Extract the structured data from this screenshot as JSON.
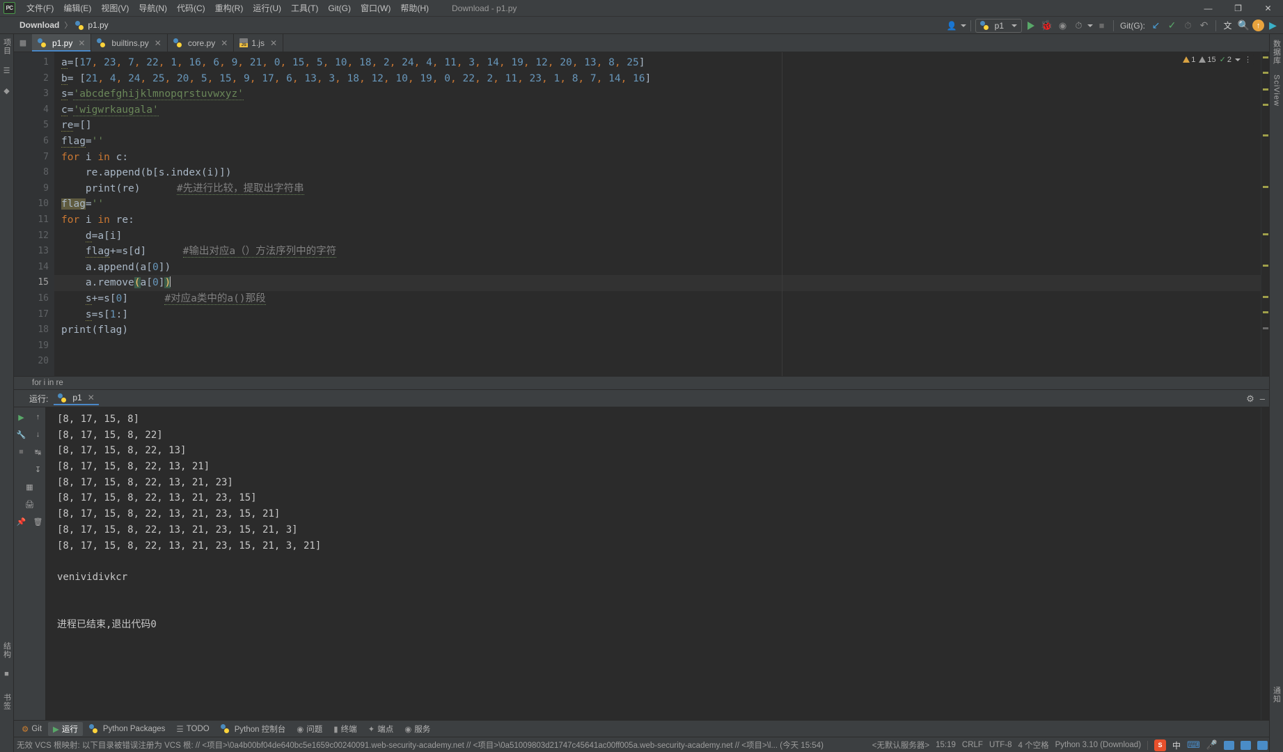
{
  "titlebar": {
    "logo": "PC",
    "menus": [
      "文件(F)",
      "编辑(E)",
      "视图(V)",
      "导航(N)",
      "代码(C)",
      "重构(R)",
      "运行(U)",
      "工具(T)",
      "Git(G)",
      "窗口(W)",
      "帮助(H)"
    ],
    "window_title": "Download - p1.py",
    "minimize": "—",
    "maximize": "❐",
    "close": "✕"
  },
  "navbar": {
    "project": "Download",
    "separator": "〉",
    "file": "p1.py",
    "run_config": "p1",
    "git_label": "Git(G):",
    "icons": {
      "user": "user-icon",
      "run": "run-icon",
      "debug": "debug-icon",
      "run_coverage": "run-with-coverage-icon",
      "profile": "profile-icon",
      "stop": "stop-icon",
      "update": "git-update-icon",
      "commit": "git-commit-icon",
      "history": "git-history-icon",
      "rollback": "git-rollback-icon",
      "translate": "translate-icon",
      "search": "search-everywhere-icon",
      "upload": "upload-icon",
      "play_gradient": "run-anything-icon"
    }
  },
  "rails": {
    "left": [
      "项目",
      "结构",
      "收藏",
      "书签",
      "结构"
    ],
    "right": [
      "数据库",
      "SciView",
      "通知"
    ]
  },
  "tabs": [
    {
      "label": "p1.py",
      "icon": "python-file-icon",
      "active": true
    },
    {
      "label": "builtins.py",
      "icon": "python-file-icon",
      "active": false
    },
    {
      "label": "core.py",
      "icon": "python-file-icon",
      "active": false
    },
    {
      "label": "1.js",
      "icon": "javascript-file-icon",
      "active": false
    }
  ],
  "inspections": {
    "warnings": "1",
    "weak_warnings": "15",
    "ok": "2"
  },
  "editor": {
    "caret_line": 15,
    "lines": [
      {
        "n": 1,
        "text": "a=[17, 23, 7, 22, 1, 16, 6, 9, 21, 0, 15, 5, 10, 18, 2, 24, 4, 11, 3, 14, 19, 12, 20, 13, 8, 25]"
      },
      {
        "n": 2,
        "text": "b= [21, 4, 24, 25, 20, 5, 15, 9, 17, 6, 13, 3, 18, 12, 10, 19, 0, 22, 2, 11, 23, 1, 8, 7, 14, 16]"
      },
      {
        "n": 3,
        "text": "s='abcdefghijklmnopqrstuvwxyz'"
      },
      {
        "n": 4,
        "text": "c='wigwrkaugala'"
      },
      {
        "n": 5,
        "text": "re=[]"
      },
      {
        "n": 6,
        "text": "flag=''"
      },
      {
        "n": 7,
        "text": "for i in c:"
      },
      {
        "n": 8,
        "text": "    re.append(b[s.index(i)])"
      },
      {
        "n": 9,
        "text": "    print(re)      #先进行比较，提取出字符串"
      },
      {
        "n": 10,
        "text": "flag=''"
      },
      {
        "n": 11,
        "text": "for i in re:"
      },
      {
        "n": 12,
        "text": "    d=a[i]"
      },
      {
        "n": 13,
        "text": "    flag+=s[d]      #输出对应a（）方法序列中的字符"
      },
      {
        "n": 14,
        "text": "    a.append(a[0])"
      },
      {
        "n": 15,
        "text": "    a.remove(a[0])"
      },
      {
        "n": 16,
        "text": "    s+=s[0]      #对应a类中的a()那段"
      },
      {
        "n": 17,
        "text": "    s=s[1:]"
      },
      {
        "n": 18,
        "text": "print(flag)"
      },
      {
        "n": 19,
        "text": ""
      },
      {
        "n": 20,
        "text": ""
      }
    ],
    "breadcrumb": "for i in re"
  },
  "run": {
    "title": "运行:",
    "tab_label": "p1",
    "tab_icon": "python-file-icon",
    "settings_icon": "gear-icon",
    "hide_icon": "minimize-icon",
    "tool_icons": [
      "rerun-icon",
      "scroll-up-icon",
      "wrench-icon",
      "scroll-down-icon",
      "stop-icon",
      "soft-wrap-icon",
      "grid-icon",
      "scroll-to-end-icon",
      "pin-icon",
      "print-icon",
      "trash-icon"
    ],
    "console": [
      "[8, 17, 15, 8]",
      "[8, 17, 15, 8, 22]",
      "[8, 17, 15, 8, 22, 13]",
      "[8, 17, 15, 8, 22, 13, 21]",
      "[8, 17, 15, 8, 22, 13, 21, 23]",
      "[8, 17, 15, 8, 22, 13, 21, 23, 15]",
      "[8, 17, 15, 8, 22, 13, 21, 23, 15, 21]",
      "[8, 17, 15, 8, 22, 13, 21, 23, 15, 21, 3]",
      "[8, 17, 15, 8, 22, 13, 21, 23, 15, 21, 3, 21]",
      "",
      "venividivkcr",
      "",
      "",
      "进程已结束,退出代码0"
    ]
  },
  "toolwindows": [
    {
      "label": "Git",
      "icon": "git-icon"
    },
    {
      "label": "运行",
      "icon": "run-icon",
      "active": true
    },
    {
      "label": "Python Packages",
      "icon": "package-icon"
    },
    {
      "label": "TODO",
      "icon": "todo-icon"
    },
    {
      "label": "Python 控制台",
      "icon": "python-console-icon"
    },
    {
      "label": "问题",
      "icon": "problems-icon"
    },
    {
      "label": "终端",
      "icon": "terminal-icon"
    },
    {
      "label": "端点",
      "icon": "breakpoints-icon"
    },
    {
      "label": "服务",
      "icon": "services-icon"
    }
  ],
  "statusbar": {
    "left": "无效 VCS 根映射: 以下目录被错误注册为 VCS 根: // <项目>\\0a4b00bf04de640bc5e1659c00240091.web-security-academy.net // <项目>\\0a51009803d21747c45641ac00ff005a.web-security-academy.net // <项目>\\l... (今天 15:54)",
    "server": "<无默认服务器>",
    "position": "15:19",
    "line_sep": "CRLF",
    "encoding": "UTF-8",
    "indent": "4 个空格",
    "interpreter": "Python 3.10 (Download)",
    "ime": "中",
    "icons": [
      "sogou-icon",
      "ime-icon",
      "keyboard-icon",
      "mic-icon",
      "window-icon",
      "grid-icon",
      "settings-icon"
    ]
  },
  "colors": {
    "bg_panel": "#3c3f41",
    "bg_editor": "#2b2b2b",
    "accent_blue": "#4a88c7",
    "green": "#59a869",
    "keyword": "#cc7832",
    "number": "#6897bb",
    "string": "#6a8759",
    "comment": "#808080",
    "text": "#a9b7c6"
  }
}
